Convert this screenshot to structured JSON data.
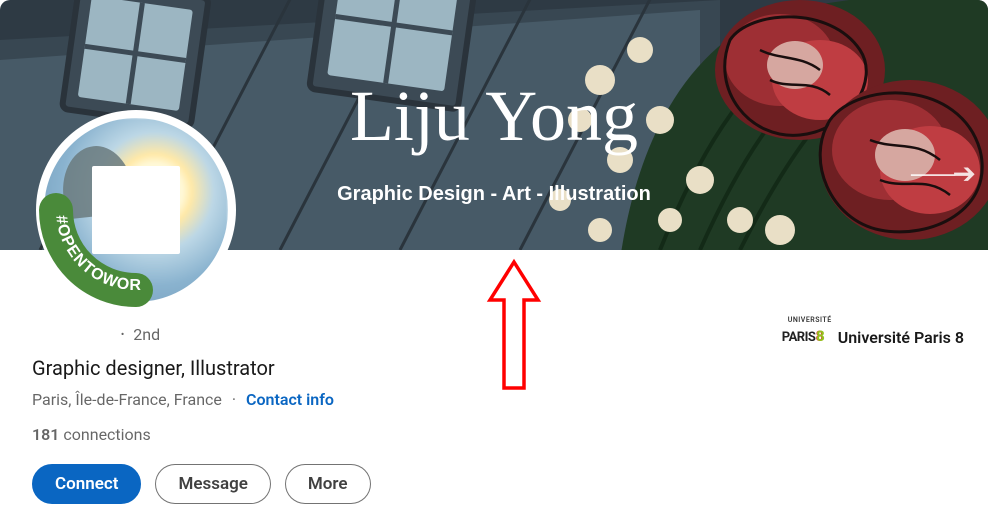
{
  "banner": {
    "signature_name": "Liju Yong",
    "tagline": "Graphic Design - Art - Illustration"
  },
  "avatar": {
    "open_to_work_label": "#OPENTOWORK"
  },
  "profile": {
    "degree_separator": "·",
    "degree": "2nd",
    "headline": "Graphic designer, Illustrator",
    "location": "Paris, Île-de-France, France",
    "contact_info_label": "Contact info",
    "connections_count": "181",
    "connections_label": "connections"
  },
  "actions": {
    "connect": "Connect",
    "message": "Message",
    "more": "More"
  },
  "education": {
    "logo_top": "UNIVERSITÉ",
    "logo_main": "PARIS",
    "name": "Université Paris 8"
  }
}
